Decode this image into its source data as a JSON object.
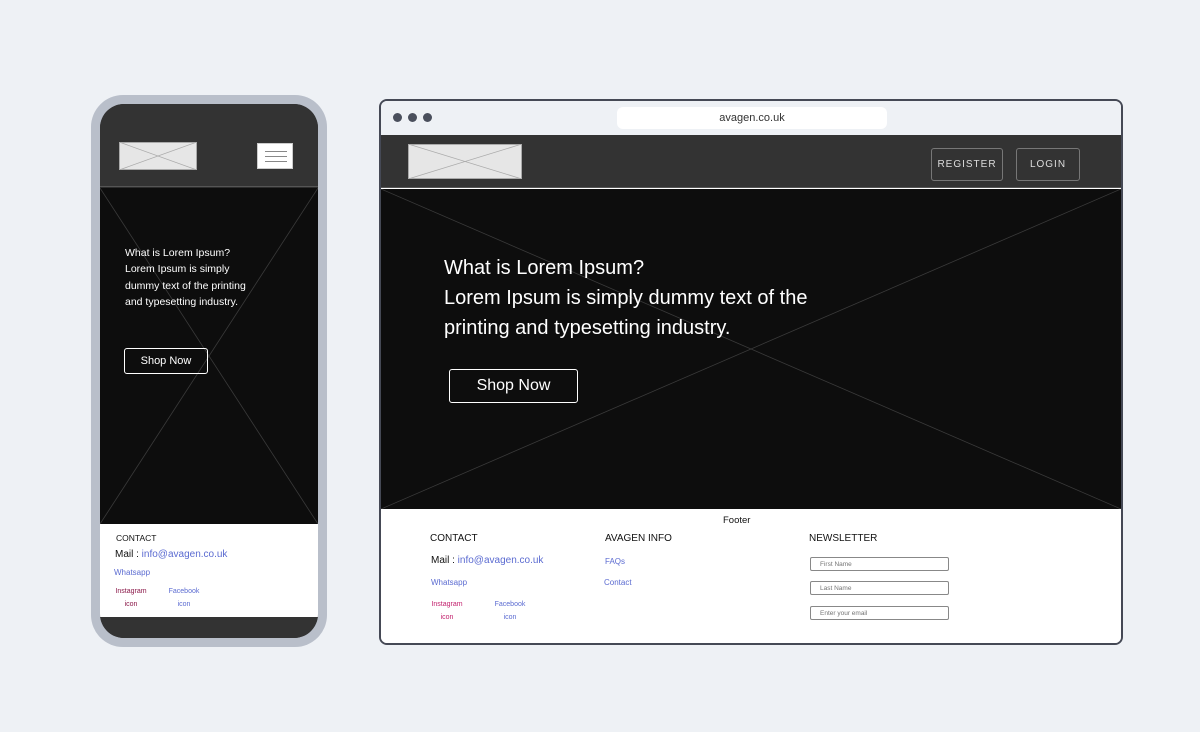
{
  "mobile": {
    "hero": {
      "line1": "What is Lorem Ipsum?",
      "line2": "Lorem Ipsum is simply",
      "line3": "dummy text of the printing",
      "line4": "and typesetting industry.",
      "cta": "Shop Now"
    },
    "footer": {
      "contact_heading": "CONTACT",
      "mail_label": "Mail : ",
      "mail_value": "info@avagen.co.uk",
      "whatsapp": "Whatsapp",
      "instagram": "Instagram",
      "instagram_icon": "icon",
      "facebook": "Facebook",
      "facebook_icon": "icon"
    }
  },
  "browser": {
    "url": "avagen.co.uk",
    "nav": {
      "register": "REGISTER",
      "login": "LOGIN"
    },
    "hero": {
      "line1": "What is Lorem Ipsum?",
      "line2": "Lorem Ipsum is simply dummy text of the",
      "line3": "printing and typesetting industry.",
      "cta": "Shop Now"
    },
    "footer": {
      "title": "Footer",
      "contact_heading": "CONTACT",
      "mail_label": "Mail : ",
      "mail_value": "info@avagen.co.uk",
      "whatsapp": "Whatsapp",
      "instagram": "Instagram",
      "instagram_icon": "icon",
      "facebook": "Facebook",
      "facebook_icon": "icon",
      "info_heading": "AVAGEN INFO",
      "faqs": "FAQs",
      "contact_link": "Contact",
      "newsletter_heading": "NEWSLETTER",
      "first_name_placeholder": "First Name",
      "last_name_placeholder": "Last Name",
      "email_placeholder": "Enter your email"
    }
  },
  "colors": {
    "page_bg": "#eef1f5",
    "dark_header": "#333333",
    "hero_bg": "#0d0d0d",
    "link": "#5b6bd1",
    "instagram_text": "#c21f6c"
  }
}
